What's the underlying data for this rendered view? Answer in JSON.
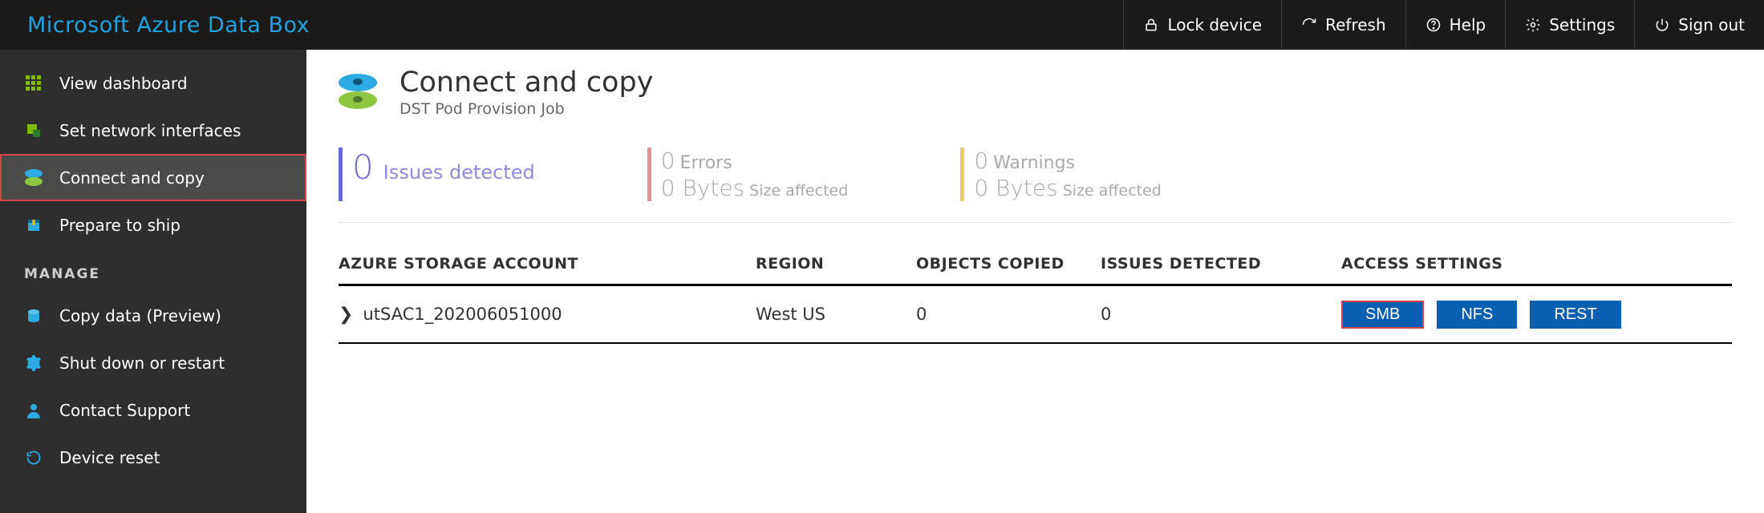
{
  "brand": "Microsoft Azure Data Box",
  "top_actions": {
    "lock": "Lock device",
    "refresh": "Refresh",
    "help": "Help",
    "settings": "Settings",
    "signout": "Sign out"
  },
  "sidebar": {
    "items": [
      {
        "label": "View dashboard"
      },
      {
        "label": "Set network interfaces"
      },
      {
        "label": "Connect and copy"
      },
      {
        "label": "Prepare to ship"
      }
    ],
    "manage_head": "MANAGE",
    "manage_items": [
      {
        "label": "Copy data (Preview)"
      },
      {
        "label": "Shut down or restart"
      },
      {
        "label": "Contact Support"
      },
      {
        "label": "Device reset"
      }
    ]
  },
  "page": {
    "title": "Connect and copy",
    "subtitle": "DST Pod Provision Job"
  },
  "stats": {
    "issues": {
      "count": "0",
      "label": "Issues detected"
    },
    "errors": {
      "count": "0",
      "label": "Errors",
      "bytes": "0 Bytes",
      "sub": "Size affected"
    },
    "warnings": {
      "count": "0",
      "label": "Warnings",
      "bytes": "0 Bytes",
      "sub": "Size affected"
    }
  },
  "table": {
    "headers": {
      "account": "AZURE STORAGE ACCOUNT",
      "region": "REGION",
      "objects": "OBJECTS COPIED",
      "issues": "ISSUES DETECTED",
      "access": "ACCESS SETTINGS"
    },
    "rows": [
      {
        "account": "utSAC1_202006051000",
        "region": "West US",
        "objects": "0",
        "issues": "0",
        "access": {
          "smb": "SMB",
          "nfs": "NFS",
          "rest": "REST"
        }
      }
    ]
  }
}
